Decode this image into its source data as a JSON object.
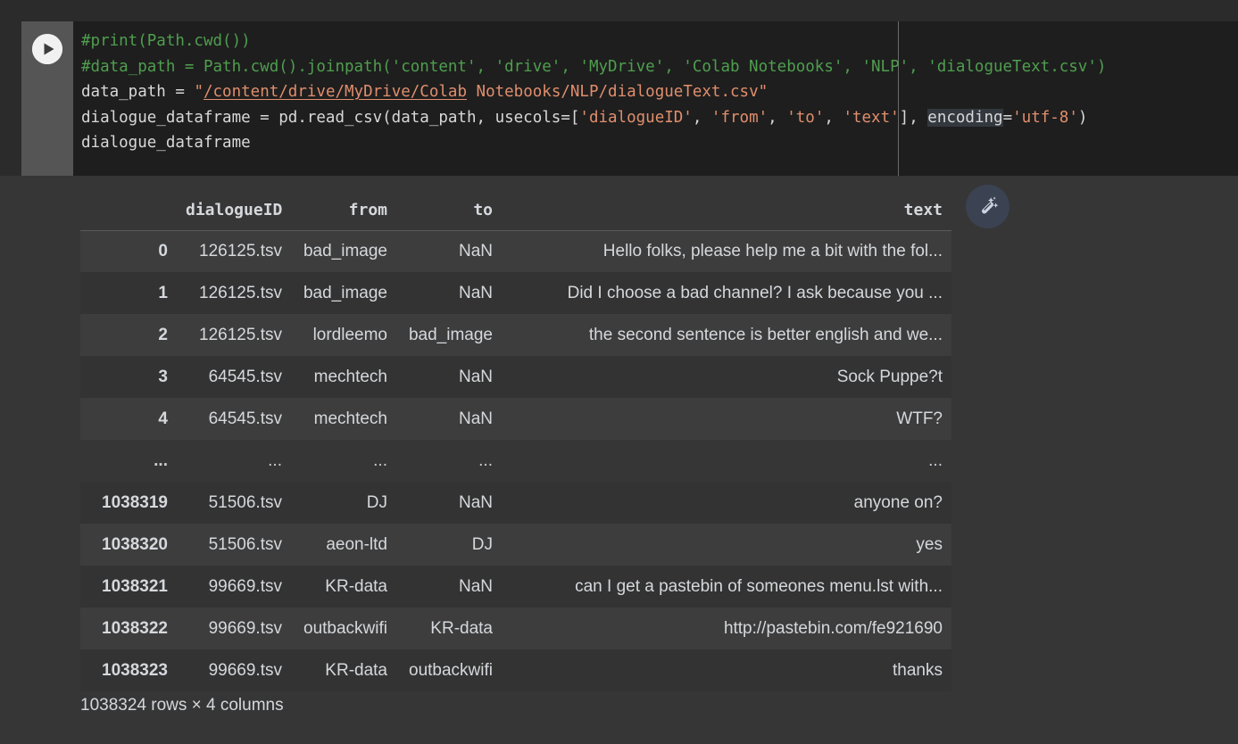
{
  "cell": {
    "run_button_label": "run-cell",
    "code_lines": [
      [
        {
          "t": "comment",
          "s": "#print(Path.cwd())"
        }
      ],
      [
        {
          "t": "comment",
          "s": "#data_path = Path.cwd().joinpath('content', 'drive', 'MyDrive', 'Colab Notebooks', 'NLP', 'dialogueText.csv')"
        }
      ],
      [
        {
          "t": "plain",
          "s": "data_path = "
        },
        {
          "t": "str",
          "s": "\""
        },
        {
          "t": "underline",
          "s": "/content/drive/MyDrive/Colab"
        },
        {
          "t": "str",
          "s": " Notebooks/NLP/dialogueText.csv\""
        }
      ],
      [
        {
          "t": "plain",
          "s": "dialogue_dataframe = pd.read_csv(data_path, usecols=["
        },
        {
          "t": "str",
          "s": "'dialogueID'"
        },
        {
          "t": "plain",
          "s": ", "
        },
        {
          "t": "str",
          "s": "'from'"
        },
        {
          "t": "plain",
          "s": ", "
        },
        {
          "t": "str",
          "s": "'to'"
        },
        {
          "t": "plain",
          "s": ", "
        },
        {
          "t": "str",
          "s": "'text'"
        },
        {
          "t": "plain",
          "s": "], "
        },
        {
          "t": "hl",
          "s": "encoding"
        },
        {
          "t": "plain",
          "s": "="
        },
        {
          "t": "str",
          "s": "'utf-8'"
        },
        {
          "t": "plain",
          "s": ")"
        }
      ],
      [
        {
          "t": "plain",
          "s": "dialogue_dataframe"
        }
      ]
    ]
  },
  "dataframe": {
    "index_header": "",
    "columns": [
      "dialogueID",
      "from",
      "to",
      "text"
    ],
    "rows": [
      {
        "index": "0",
        "cells": [
          "126125.tsv",
          "bad_image",
          "NaN",
          "Hello folks, please help me a bit with the fol..."
        ]
      },
      {
        "index": "1",
        "cells": [
          "126125.tsv",
          "bad_image",
          "NaN",
          "Did I choose a bad channel? I ask because you ..."
        ]
      },
      {
        "index": "2",
        "cells": [
          "126125.tsv",
          "lordleemo",
          "bad_image",
          "the second sentence is better english and we..."
        ]
      },
      {
        "index": "3",
        "cells": [
          "64545.tsv",
          "mechtech",
          "NaN",
          "Sock Puppe?t"
        ]
      },
      {
        "index": "4",
        "cells": [
          "64545.tsv",
          "mechtech",
          "NaN",
          "WTF?"
        ]
      },
      {
        "index": "...",
        "ellipsis": true,
        "cells": [
          "...",
          "...",
          "...",
          "..."
        ]
      },
      {
        "index": "1038319",
        "cells": [
          "51506.tsv",
          "DJ",
          "NaN",
          "anyone on?"
        ]
      },
      {
        "index": "1038320",
        "cells": [
          "51506.tsv",
          "aeon-ltd",
          "DJ",
          "yes"
        ]
      },
      {
        "index": "1038321",
        "cells": [
          "99669.tsv",
          "KR-data",
          "NaN",
          "can I get a pastebin of someones menu.lst with..."
        ]
      },
      {
        "index": "1038322",
        "cells": [
          "99669.tsv",
          "outbackwifi",
          "KR-data",
          "http://pastebin.com/fe921690"
        ]
      },
      {
        "index": "1038323",
        "cells": [
          "99669.tsv",
          "KR-data",
          "outbackwifi",
          "thanks"
        ]
      }
    ],
    "footer": "1038324 rows × 4 columns"
  },
  "colors": {
    "page_background": "#2b2b2b",
    "code_background": "#1e1e1e",
    "gutter": "#555555",
    "output_background": "#363636",
    "row_odd": "#3d3d3d",
    "row_even": "#333333",
    "comment": "#4f9e4f",
    "string": "#e08e6d",
    "text": "#d5d8dc",
    "wand_button": "#3b4252"
  }
}
